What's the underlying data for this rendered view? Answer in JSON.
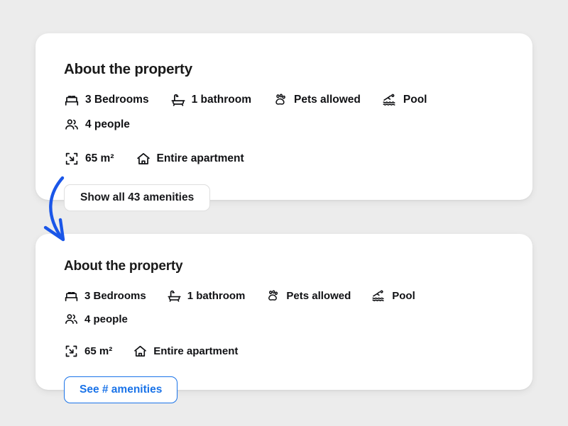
{
  "page": {
    "background_color": "#ececec",
    "accent_color": "#1a73e8",
    "text_color": "#101114"
  },
  "annotation": {
    "arrow": {
      "name": "curved-down-arrow",
      "color": "#1a73e8",
      "description": "curved arrow pointing from the first card down to the second card"
    }
  },
  "cards": [
    {
      "id": "original-card",
      "heading": "About the property",
      "features": [
        {
          "icon": "bed-icon",
          "label": "3 Bedrooms"
        },
        {
          "icon": "bathtub-icon",
          "label": "1 bathroom"
        },
        {
          "icon": "paw-icon",
          "label": "Pets allowed"
        },
        {
          "icon": "pool-icon",
          "label": "Pool"
        },
        {
          "icon": "people-icon",
          "label": "4 people"
        },
        {
          "icon": "area-icon",
          "label": "65 m²"
        },
        {
          "icon": "home-icon",
          "label": "Entire apartment"
        }
      ],
      "button": {
        "label": "Show all 43 amenities",
        "style": "outline-gray",
        "border_color": "#dedede",
        "text_color": "#17181b"
      }
    },
    {
      "id": "variant-card",
      "heading": "About the property",
      "features": [
        {
          "icon": "bed-icon",
          "label": "3 Bedrooms"
        },
        {
          "icon": "bathtub-icon",
          "label": "1 bathroom"
        },
        {
          "icon": "paw-icon",
          "label": "Pets allowed"
        },
        {
          "icon": "pool-icon",
          "label": "Pool"
        },
        {
          "icon": "people-icon",
          "label": "4 people"
        },
        {
          "icon": "area-icon",
          "label": "65 m²"
        },
        {
          "icon": "home-icon",
          "label": "Entire apartment"
        }
      ],
      "button": {
        "label": "See # amenities",
        "style": "outline-blue",
        "border_color": "#1a73e8",
        "text_color": "#1a73e8"
      }
    }
  ]
}
